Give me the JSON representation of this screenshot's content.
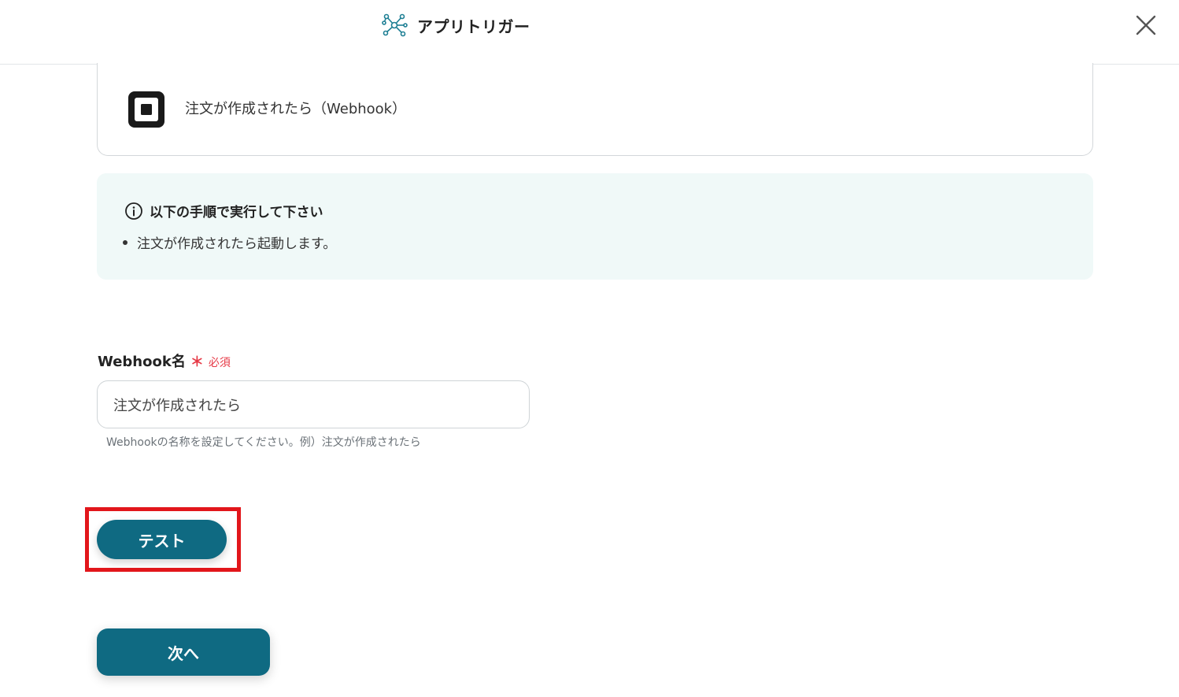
{
  "header": {
    "title": "アプリトリガー",
    "icon": "network-nodes-icon",
    "close_icon": "close-icon"
  },
  "app_card": {
    "logo_icon": "square-logo-icon",
    "trigger_name": "注文が作成されたら（Webhook）"
  },
  "info": {
    "icon": "info-circle-icon",
    "title": "以下の手順で実行して下さい",
    "items": [
      "注文が作成されたら起動します。"
    ]
  },
  "webhook_field": {
    "label": "Webhook名",
    "required_mark": "＊",
    "required_text": "必須",
    "value": "注文が作成されたら",
    "help": "Webhookの名称を設定してください。例）注文が作成されたら"
  },
  "buttons": {
    "test": "テスト",
    "next": "次へ"
  },
  "colors": {
    "primary": "#0f6a82",
    "info_bg": "#f0f9f8",
    "required": "#e63946",
    "highlight": "#e2161b"
  }
}
